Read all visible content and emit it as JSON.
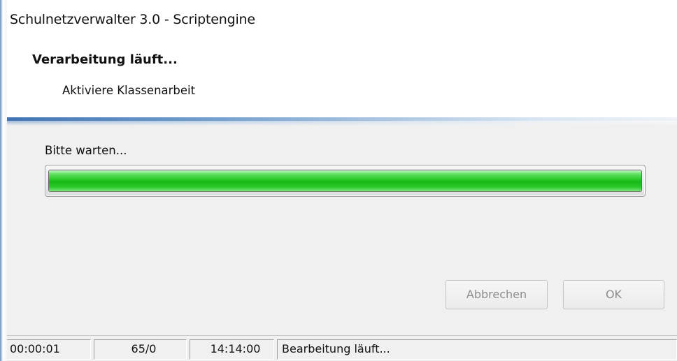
{
  "window": {
    "title": "Schulnetzverwalter 3.0 - Scriptengine"
  },
  "header": {
    "heading": "Verarbeitung läuft...",
    "subheading": "Aktiviere Klassenarbeit"
  },
  "content": {
    "wait_label": "Bitte warten...",
    "progress_fraction": 1.0
  },
  "buttons": {
    "cancel_label": "Abbrechen",
    "ok_label": "OK"
  },
  "statusbar": {
    "elapsed": "00:00:01",
    "count": "65/0",
    "time": "14:14:00",
    "status": "Bearbeitung läuft..."
  },
  "colors": {
    "progress_fill": "#25c825",
    "header_separator": "#3f72b3"
  }
}
